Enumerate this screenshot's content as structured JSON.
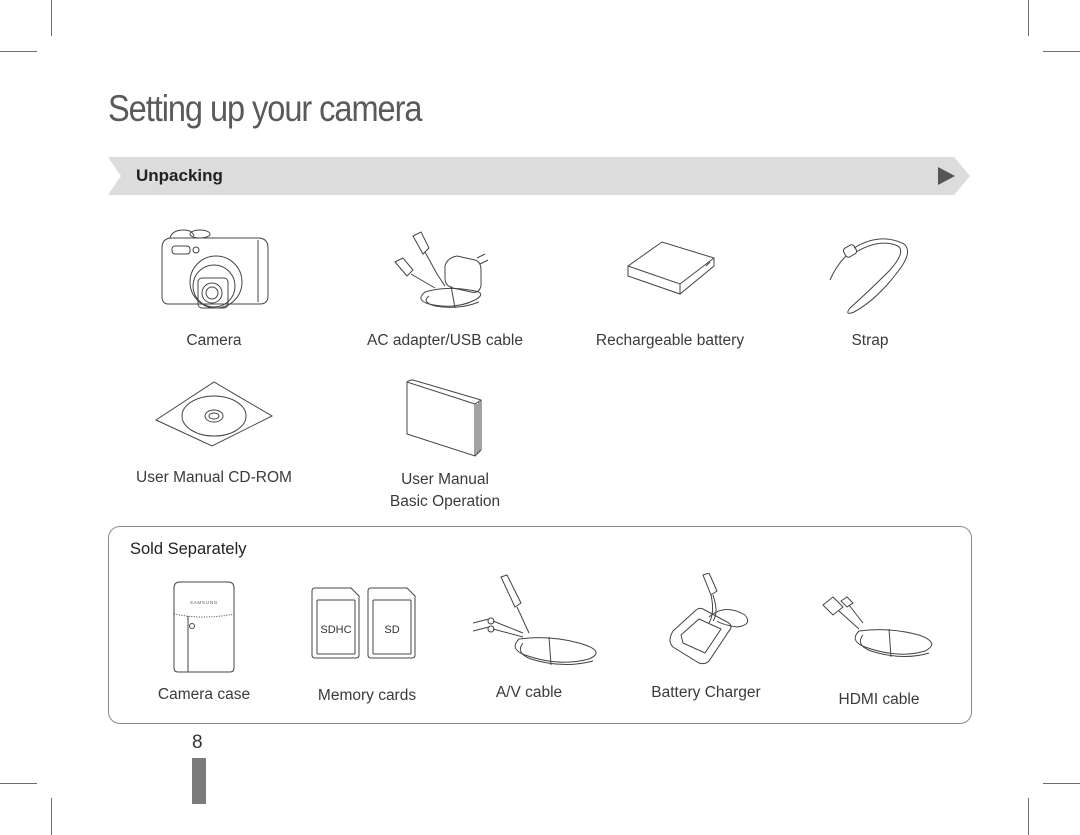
{
  "page": {
    "title": "Setting up your camera",
    "section_title": "Unpacking",
    "page_number": "8"
  },
  "included_items": [
    {
      "label": "Camera",
      "icon": "camera-icon"
    },
    {
      "label": "AC adapter/USB cable",
      "icon": "ac-adapter-icon"
    },
    {
      "label": "Rechargeable battery",
      "icon": "battery-icon"
    },
    {
      "label": "Strap",
      "icon": "strap-icon"
    },
    {
      "label": "User Manual CD-ROM",
      "icon": "cd-rom-icon"
    },
    {
      "label": "User Manual",
      "label2": "Basic Operation",
      "icon": "manual-book-icon"
    }
  ],
  "sold_separately": {
    "title": "Sold Separately",
    "items": [
      {
        "label": "Camera case",
        "icon": "camera-case-icon",
        "brand": "SAMSUNG"
      },
      {
        "label": "Memory cards",
        "icon": "memory-cards-icon",
        "card1": "SDHC",
        "card2": "SD"
      },
      {
        "label": "A/V cable",
        "icon": "av-cable-icon"
      },
      {
        "label": "Battery Charger",
        "icon": "battery-charger-icon"
      },
      {
        "label": "HDMI cable",
        "icon": "hdmi-cable-icon"
      }
    ]
  },
  "colors": {
    "banner": "#dcdcdc",
    "arrow": "#555555",
    "title": "#5a5a5a",
    "page_tab": "#7b7b7b"
  }
}
